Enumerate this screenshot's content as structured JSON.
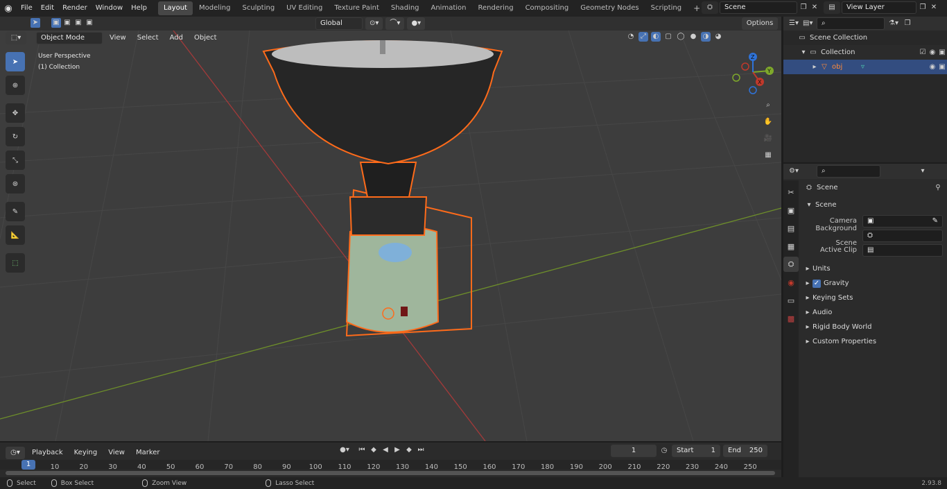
{
  "menu": {
    "items": [
      "File",
      "Edit",
      "Render",
      "Window",
      "Help"
    ]
  },
  "workspaces": {
    "tabs": [
      "Layout",
      "Modeling",
      "Sculpting",
      "UV Editing",
      "Texture Paint",
      "Shading",
      "Animation",
      "Rendering",
      "Compositing",
      "Geometry Nodes",
      "Scripting"
    ],
    "add": "+"
  },
  "topright": {
    "scene": "Scene",
    "view_layer": "View Layer"
  },
  "viewport": {
    "mode": "Object Mode",
    "menus": [
      "View",
      "Select",
      "Add",
      "Object"
    ],
    "transform": "Global",
    "options": "Options",
    "overlay_title": "User Perspective",
    "overlay_collection": "(1) Collection",
    "gizmo": {
      "x": "X",
      "y": "Y",
      "z": "Z"
    }
  },
  "outliner": {
    "scene_collection": "Scene Collection",
    "collection": "Collection",
    "object": "obj"
  },
  "properties": {
    "header": "Scene",
    "section": "Scene",
    "rows": [
      {
        "label": "Camera"
      },
      {
        "label": "Background Scene"
      },
      {
        "label": "Active Clip"
      }
    ],
    "subpanels": [
      "Units",
      "Gravity",
      "Keying Sets",
      "Audio",
      "Rigid Body World",
      "Custom Properties"
    ],
    "gravity_checked": true
  },
  "timeline": {
    "menus": [
      "Playback",
      "Keying",
      "View",
      "Marker"
    ],
    "current_frame": "1",
    "start_label": "Start",
    "start": "1",
    "end_label": "End",
    "end": "250",
    "ticks": [
      "10",
      "20",
      "30",
      "40",
      "50",
      "60",
      "70",
      "80",
      "90",
      "100",
      "110",
      "120",
      "130",
      "140",
      "150",
      "160",
      "170",
      "180",
      "190",
      "200",
      "210",
      "220",
      "230",
      "240",
      "250"
    ],
    "playhead": "1"
  },
  "statusbar": {
    "items": [
      "Select",
      "Box Select",
      "Zoom View",
      "Lasso Select"
    ],
    "version": "2.93.8"
  },
  "colors": {
    "accent": "#4772b3",
    "selection": "#ff6b1a",
    "axis_x": "#c0392b",
    "axis_y": "#7ea82b"
  }
}
